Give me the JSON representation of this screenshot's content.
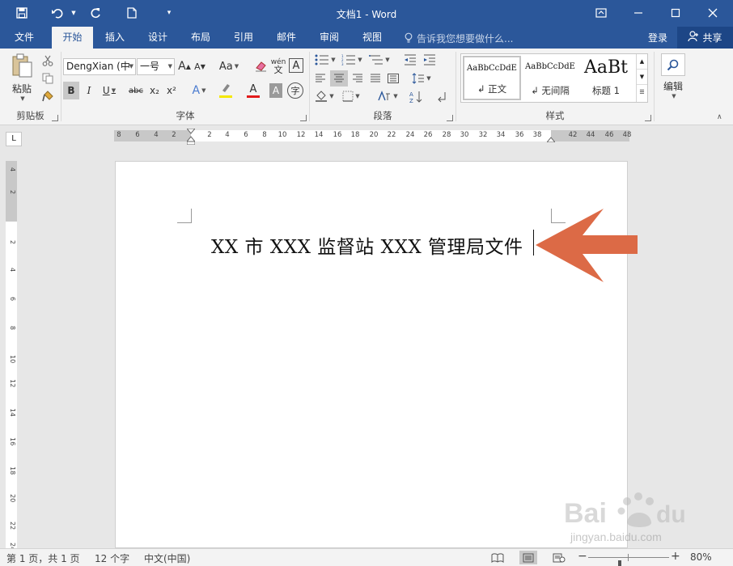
{
  "window": {
    "title": "文档1 - Word",
    "accent": "#2b579a"
  },
  "quick_access": {
    "icons": [
      "save-icon",
      "undo-icon",
      "redo-icon",
      "new-document-icon",
      "customize-icon"
    ]
  },
  "tabs": [
    {
      "label": "文件"
    },
    {
      "label": "开始",
      "active": true
    },
    {
      "label": "插入"
    },
    {
      "label": "设计"
    },
    {
      "label": "布局"
    },
    {
      "label": "引用"
    },
    {
      "label": "邮件"
    },
    {
      "label": "审阅"
    },
    {
      "label": "视图"
    }
  ],
  "tell_me": "告诉我您想要做什么...",
  "sign_in": "登录",
  "share": "共享",
  "ribbon": {
    "clipboard": {
      "label": "剪贴板",
      "paste": "粘贴"
    },
    "font": {
      "label": "字体",
      "font_name": "DengXian (中",
      "font_size": "一号",
      "change_case": "Aa",
      "bold": "B",
      "italic": "I",
      "underline": "U",
      "strike": "abc",
      "sub": "x₂",
      "sup": "x²",
      "grow": "A",
      "shrink": "A",
      "phonetic": "wén",
      "phonetic_char": "文",
      "border_char": "A",
      "font_color_char": "A",
      "shade_char": "A",
      "enclose_char": "字"
    },
    "paragraph": {
      "label": "段落"
    },
    "styles": {
      "label": "样式",
      "items": [
        {
          "sample": "AaBbCcDdE",
          "name": "↲ 正文"
        },
        {
          "sample": "AaBbCcDdE",
          "name": "↲ 无间隔"
        },
        {
          "sample": "AaBt",
          "name": "标题 1"
        }
      ]
    },
    "editing": {
      "label": "编辑"
    }
  },
  "ruler": {
    "h_ticks": [
      "8",
      "6",
      "4",
      "2",
      "2",
      "4",
      "6",
      "8",
      "10",
      "12",
      "14",
      "16",
      "18",
      "20",
      "22",
      "24",
      "26",
      "28",
      "30",
      "32",
      "34",
      "36",
      "38",
      "42",
      "44",
      "46",
      "48"
    ],
    "v_ticks": [
      "4",
      "2",
      "2",
      "4",
      "6",
      "8",
      "10",
      "12",
      "14",
      "16",
      "18",
      "20",
      "22",
      "24"
    ],
    "tab_selector": "L"
  },
  "document": {
    "text": "XX 市 XXX 监督站 XXX 管理局文件"
  },
  "status": {
    "page": "第 1 页，共 1 页",
    "words": "12 个字",
    "language": "中文(中国)",
    "zoom": "80%",
    "zoom_level": 0.8
  },
  "watermark": {
    "brand": "Baidu经验",
    "url": "jingyan.baidu.com"
  }
}
